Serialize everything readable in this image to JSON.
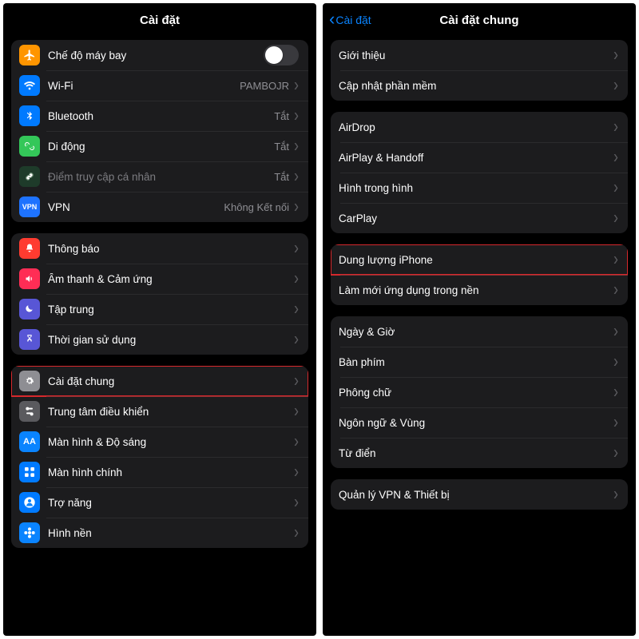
{
  "left": {
    "title": "Cài đặt",
    "groups": [
      [
        {
          "icon": "airplane",
          "label": "Chế độ máy bay",
          "toggle": true
        },
        {
          "icon": "wifi",
          "label": "Wi-Fi",
          "value": "PAMBOJR",
          "chevron": true
        },
        {
          "icon": "bluetooth",
          "label": "Bluetooth",
          "value": "Tắt",
          "chevron": true
        },
        {
          "icon": "cellular",
          "label": "Di động",
          "value": "Tắt",
          "chevron": true
        },
        {
          "icon": "hotspot",
          "label": "Điểm truy cập cá nhân",
          "value": "Tắt",
          "chevron": true,
          "dim": true
        },
        {
          "icon": "vpn",
          "label": "VPN",
          "value": "Không Kết nối",
          "chevron": true
        }
      ],
      [
        {
          "icon": "notifications",
          "label": "Thông báo",
          "chevron": true
        },
        {
          "icon": "sounds",
          "label": "Âm thanh & Cảm ứng",
          "chevron": true
        },
        {
          "icon": "focus",
          "label": "Tập trung",
          "chevron": true
        },
        {
          "icon": "screentime",
          "label": "Thời gian sử dụng",
          "chevron": true
        }
      ],
      [
        {
          "icon": "general",
          "label": "Cài đặt chung",
          "chevron": true,
          "highlight": true
        },
        {
          "icon": "control",
          "label": "Trung tâm điều khiển",
          "chevron": true
        },
        {
          "icon": "display",
          "label": "Màn hình & Độ sáng",
          "chevron": true
        },
        {
          "icon": "home",
          "label": "Màn hình chính",
          "chevron": true
        },
        {
          "icon": "accessibility",
          "label": "Trợ năng",
          "chevron": true
        },
        {
          "icon": "wallpaper",
          "label": "Hình nền",
          "chevron": true
        }
      ]
    ]
  },
  "right": {
    "title": "Cài đặt chung",
    "back": "Cài đặt",
    "groups": [
      [
        {
          "label": "Giới thiệu",
          "chevron": true
        },
        {
          "label": "Cập nhật phần mềm",
          "chevron": true
        }
      ],
      [
        {
          "label": "AirDrop",
          "chevron": true
        },
        {
          "label": "AirPlay & Handoff",
          "chevron": true
        },
        {
          "label": "Hình trong hình",
          "chevron": true
        },
        {
          "label": "CarPlay",
          "chevron": true
        }
      ],
      [
        {
          "label": "Dung lượng iPhone",
          "chevron": true,
          "highlight": true
        },
        {
          "label": "Làm mới ứng dụng trong nền",
          "chevron": true
        }
      ],
      [
        {
          "label": "Ngày & Giờ",
          "chevron": true
        },
        {
          "label": "Bàn phím",
          "chevron": true
        },
        {
          "label": "Phông chữ",
          "chevron": true
        },
        {
          "label": "Ngôn ngữ & Vùng",
          "chevron": true
        },
        {
          "label": "Từ điển",
          "chevron": true
        }
      ],
      [
        {
          "label": "Quản lý VPN & Thiết bị",
          "chevron": true
        }
      ]
    ]
  },
  "iconset": {
    "airplane": {
      "cls": "bg-orange",
      "glyph": "airplane"
    },
    "wifi": {
      "cls": "bg-blue",
      "glyph": "wifi"
    },
    "bluetooth": {
      "cls": "bg-blue",
      "glyph": "bluetooth"
    },
    "cellular": {
      "cls": "bg-green",
      "glyph": "cellular"
    },
    "hotspot": {
      "cls": "bg-dimgreen",
      "glyph": "link"
    },
    "vpn": {
      "cls": "bg-vpnblue",
      "text": "VPN"
    },
    "notifications": {
      "cls": "bg-red",
      "glyph": "bell"
    },
    "sounds": {
      "cls": "bg-pink",
      "glyph": "speaker"
    },
    "focus": {
      "cls": "bg-indigo",
      "glyph": "moon"
    },
    "screentime": {
      "cls": "bg-indigo",
      "glyph": "hourglass"
    },
    "general": {
      "cls": "bg-gray",
      "glyph": "gear"
    },
    "control": {
      "cls": "bg-darkgray",
      "glyph": "sliders"
    },
    "display": {
      "cls": "bg-aablue",
      "text": "AA"
    },
    "home": {
      "cls": "bg-blue",
      "glyph": "grid"
    },
    "accessibility": {
      "cls": "bg-blue",
      "glyph": "person"
    },
    "wallpaper": {
      "cls": "bg-cyan",
      "glyph": "flower"
    }
  }
}
